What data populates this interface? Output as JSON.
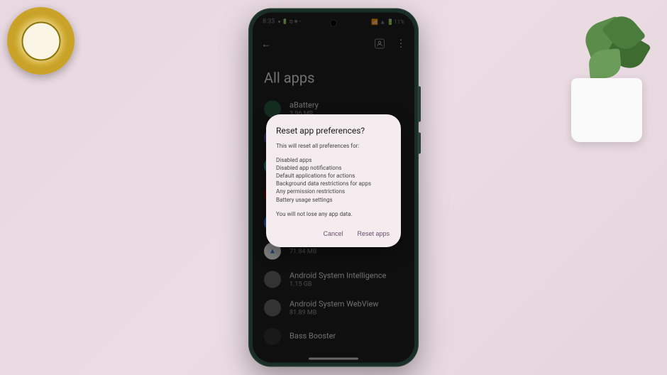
{
  "statusbar": {
    "time": "8:33",
    "icons_left": "● 🔋 ⧉ ✱ •",
    "battery": "📶 ▲ 🔋11%"
  },
  "appbar": {
    "back": "←",
    "profile_icon": "👤",
    "menu": "⋮"
  },
  "page": {
    "title": "All apps"
  },
  "apps": [
    {
      "name": "aBattery",
      "size": "3.96 MB",
      "color": "#2b5a3f"
    },
    {
      "name": "",
      "size": "",
      "color": "#3b5998"
    },
    {
      "name": "",
      "size": "",
      "color": "#26a69a"
    },
    {
      "name": "",
      "size": "",
      "color": "#8b0000"
    },
    {
      "name": "",
      "size": "",
      "color": "#4285f4"
    },
    {
      "name": "",
      "size": "71.84 MB",
      "color": "#ffffff"
    },
    {
      "name": "Android System Intelligence",
      "size": "1.15 GB",
      "color": "#666"
    },
    {
      "name": "Android System WebView",
      "size": "81.89 MB",
      "color": "#666"
    },
    {
      "name": "Bass Booster",
      "size": "",
      "color": "#333"
    }
  ],
  "dialog": {
    "title": "Reset app preferences?",
    "subtitle": "This will reset all preferences for:",
    "items": [
      "Disabled apps",
      "Disabled app notifications",
      "Default applications for actions",
      "Background data restrictions for apps",
      "Any permission restrictions",
      "Battery usage settings"
    ],
    "note": "You will not lose any app data.",
    "cancel": "Cancel",
    "confirm": "Reset apps"
  }
}
